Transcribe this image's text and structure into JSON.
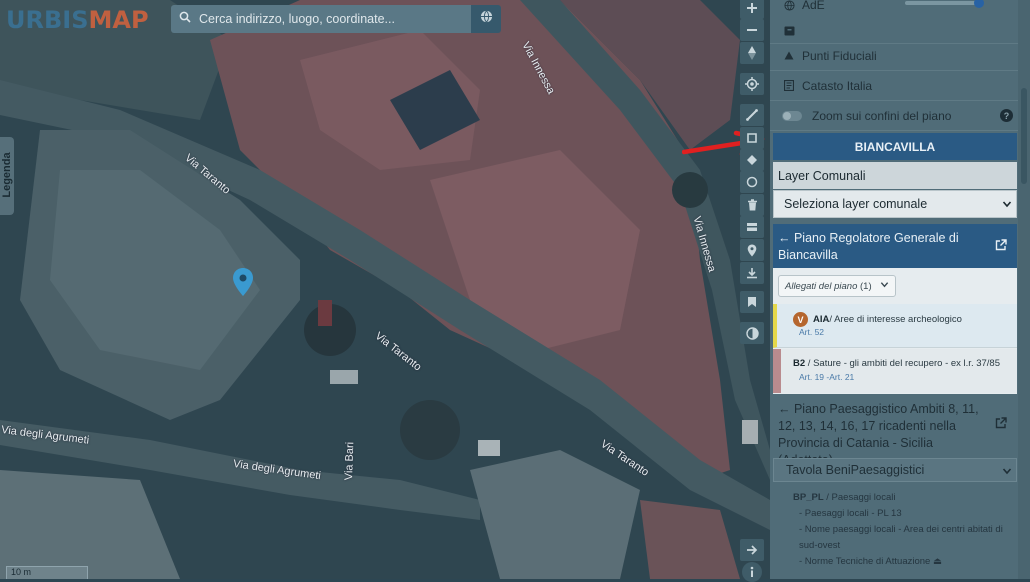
{
  "app": {
    "logo_part1": "URBIS",
    "logo_part2": "MAP"
  },
  "search": {
    "placeholder": "Cerca indirizzo, luogo, coordinate..."
  },
  "legenda": "Legenda",
  "scale": "10 m",
  "roads": [
    "Via Innessa",
    "Via Taranto",
    "Via Taranto",
    "Via Innessa",
    "Via Taranto",
    "Via degli Agrumeti",
    "Via degli Agrumeti",
    "Via Bari"
  ],
  "panel": {
    "top_item": "AdE",
    "items": [
      "Punti Fiduciali",
      "Catasto Italia"
    ],
    "zoom_toggle": "Zoom sui confini del piano",
    "municipality": "BIANCAVILLA",
    "layer_comunali": "Layer Comunali",
    "select_layer": "Seleziona layer comunale",
    "prg_title": "← Piano Regolatore Generale di Biancavilla",
    "allegati_label": "Allegati del piano",
    "allegati_count": "(1)",
    "zone_aia": {
      "badge": "V",
      "code": "AIA",
      "desc": " / Aree di interesse archeologico",
      "art": "Art. 52"
    },
    "zone_b2": {
      "code": "B2",
      "desc": " / Sature - gli ambiti del recupero - ex l.r. 37/85",
      "art": "Art. 19 -Art. 21"
    },
    "ppa_title": "← Piano Paesaggistico Ambiti 8, 11, 12, 13, 14, 16, 17 ricadenti nella Provincia di Catania - Sicilia (Adottato)",
    "tavola": "Tavola BeniPaesaggistici",
    "tavola_code": "BP_PL",
    "tavola_desc": " / Paesaggi locali",
    "tavola_lines": [
      "- Paesaggi locali - PL 13",
      "- Nome paesaggi locali - Area dei centri abitati di",
      "sud-ovest",
      "- Norme Tecniche di Attuazione"
    ]
  },
  "colors": {
    "accent": "#2a5a84",
    "marker": "#3a9ad0",
    "arrow": "#e02020"
  }
}
